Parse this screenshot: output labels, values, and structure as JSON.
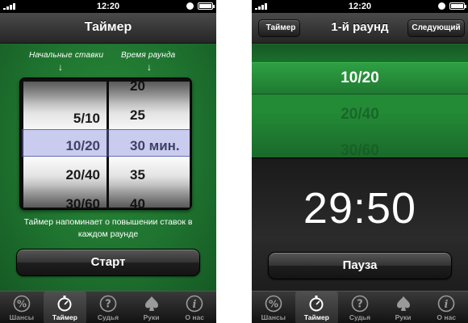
{
  "left": {
    "status": {
      "time": "12:20"
    },
    "nav": {
      "title": "Таймер"
    },
    "hints": {
      "initial_bets": "Начальные ставки",
      "round_time": "Время раунда"
    },
    "picker": {
      "blinds": [
        "",
        "5/10",
        "10/20",
        "20/40",
        "30/60"
      ],
      "minutes": [
        "20",
        "25",
        "30 мин.",
        "35",
        "40"
      ],
      "selected_blinds": "10/20",
      "selected_minutes": "30 мин."
    },
    "info": "Таймер напоминает о повышении ставок в каждом раунде",
    "start_label": "Старт"
  },
  "right": {
    "status": {
      "time": "12:20"
    },
    "nav": {
      "back": "Таймер",
      "title": "1-й раунд",
      "next": "Следующий"
    },
    "rounds": [
      "10/20",
      "20/40",
      "30/60"
    ],
    "countdown": "29:50",
    "pause_label": "Пауза"
  },
  "tabs": [
    {
      "label": "Шансы",
      "icon": "percent-icon"
    },
    {
      "label": "Таймер",
      "icon": "stopwatch-icon"
    },
    {
      "label": "Судья",
      "icon": "question-icon"
    },
    {
      "label": "Руки",
      "icon": "spade-icon"
    },
    {
      "label": "О нас",
      "icon": "info-icon"
    }
  ],
  "active_tab": "Таймер",
  "colors": {
    "felt": "#1f7430",
    "highlight": "#7882dc",
    "bar": "#262626"
  }
}
